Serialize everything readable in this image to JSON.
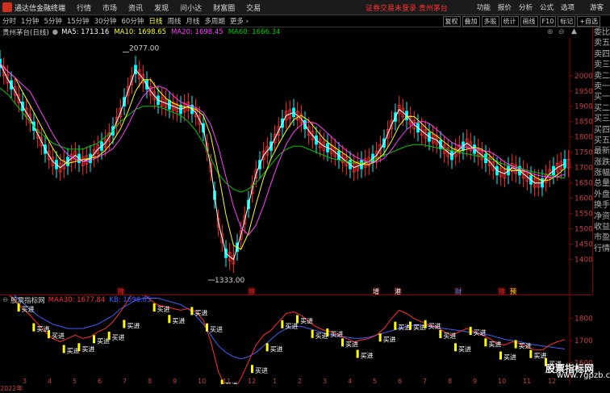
{
  "menubar": {
    "app_title": "通达信金融终端",
    "items": [
      "行情",
      "市场",
      "资讯",
      "发现",
      "问小达",
      "财富圈",
      "交易"
    ],
    "notice": "证券交易未登录",
    "notice_stock": "贵州茅台",
    "right_items": [
      "功能",
      "报价",
      "分析",
      "公式",
      "选项"
    ],
    "guest": "游客"
  },
  "toolbar": {
    "periods": [
      "分时",
      "1分钟",
      "5分钟",
      "15分钟",
      "30分钟",
      "60分钟",
      "日线",
      "周线",
      "月线",
      "多周期",
      "更多"
    ],
    "active_period": "日线",
    "buttons": [
      "复权",
      "叠加",
      "多股",
      "统计",
      "画线",
      "F10",
      "标记",
      "+自选"
    ]
  },
  "info": {
    "stock": "贵州茅台(日线)",
    "ma5_label": "MA5: 1713.16",
    "ma10_label": "MA10: 1698.65",
    "ma20_label": "MA20: 1698.45",
    "ma60_label": "MA60: 1666.34"
  },
  "colors": {
    "ma5": "#ffffff",
    "ma10": "#ffff00",
    "ma20": "#ff40ff",
    "ma60": "#00cc00",
    "up": "#ff3030",
    "down": "#00ffff",
    "panel": "#8b0000"
  },
  "side_panel": [
    "委比",
    "卖五",
    "卖四",
    "卖三",
    "卖二",
    "卖一",
    "买一",
    "买二",
    "买三",
    "买四",
    "买五",
    "最新",
    "涨跌",
    "涨幅",
    "总量",
    "外盘",
    "换手",
    "净资",
    "收益",
    "市盈",
    "行情"
  ],
  "chart_data": {
    "type": "line",
    "ylim": [
      1320,
      2110
    ],
    "y_ticks": [
      2000,
      1950,
      1900,
      1850,
      1800,
      1750,
      1700,
      1650,
      1600,
      1550,
      1500,
      1450,
      1400
    ],
    "high_label": "2077.00",
    "low_label": "1333.00",
    "x_ticks": [
      "2022年",
      "3",
      "4",
      "5",
      "6",
      "7",
      "8",
      "9",
      "10",
      "11",
      "12",
      "1",
      "2",
      "3",
      "4",
      "5",
      "6",
      "7",
      "8",
      "9",
      "10",
      "11",
      "12"
    ],
    "series": [
      {
        "name": "MA5",
        "values": [
          2040,
          1990,
          1950,
          1900,
          1860,
          1810,
          1760,
          1720,
          1700,
          1720,
          1740,
          1720,
          1730,
          1760,
          1780,
          1820,
          1880,
          1950,
          2020,
          1990,
          1950,
          1920,
          1910,
          1900,
          1890,
          1900,
          1880,
          1830,
          1700,
          1520,
          1420,
          1400,
          1480,
          1580,
          1680,
          1740,
          1770,
          1820,
          1870,
          1880,
          1860,
          1820,
          1790,
          1770,
          1760,
          1740,
          1720,
          1700,
          1710,
          1720,
          1740,
          1780,
          1840,
          1890,
          1870,
          1840,
          1820,
          1800,
          1790,
          1760,
          1740,
          1760,
          1780,
          1760,
          1740,
          1720,
          1690,
          1680,
          1700,
          1690,
          1670,
          1650,
          1650,
          1680,
          1700,
          1713
        ]
      },
      {
        "name": "MA60",
        "values": [
          1960,
          1940,
          1910,
          1880,
          1850,
          1820,
          1800,
          1780,
          1770,
          1760,
          1760,
          1760,
          1770,
          1780,
          1800,
          1820,
          1850,
          1870,
          1890,
          1900,
          1900,
          1900,
          1890,
          1880,
          1870,
          1850,
          1820,
          1780,
          1730,
          1680,
          1650,
          1630,
          1620,
          1630,
          1650,
          1680,
          1710,
          1740,
          1760,
          1770,
          1770,
          1760,
          1750,
          1740,
          1730,
          1725,
          1720,
          1715,
          1715,
          1720,
          1730,
          1740,
          1750,
          1760,
          1770,
          1775,
          1775,
          1770,
          1765,
          1760,
          1755,
          1750,
          1745,
          1740,
          1735,
          1730,
          1720,
          1710,
          1705,
          1700,
          1690,
          1685,
          1680,
          1675,
          1670,
          1666
        ]
      }
    ],
    "markers": [
      "除",
      "除",
      "增",
      "港",
      "财",
      "除",
      "预"
    ]
  },
  "indicator": {
    "name": "股票指标网",
    "maa30_label": "MAA30: 1677.84",
    "kb_label": "KB: 1698.65",
    "y_ticks": [
      1800,
      1700,
      1600
    ],
    "signal_label": "买进",
    "signal_count": 36
  },
  "watermark": {
    "name": "股票指标网",
    "site": "www.7gpzb.com"
  }
}
